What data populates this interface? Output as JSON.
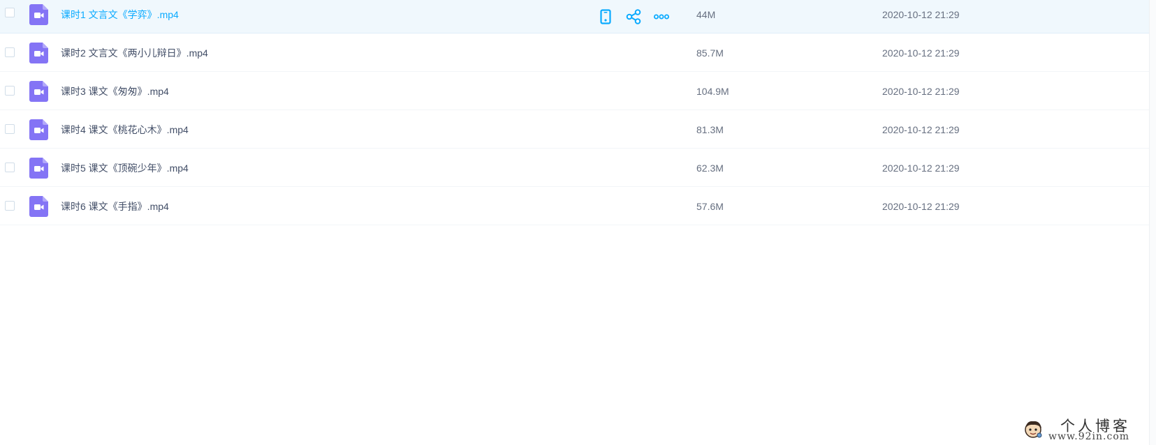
{
  "colors": {
    "accent": "#09aaff",
    "video_icon": "#8474f5",
    "row_highlight": "#f0f8fd",
    "text": "#424e67",
    "meta_text": "#666f80"
  },
  "files": [
    {
      "name": "课时1 文言文《学弈》.mp4",
      "size": "44M",
      "mtime": "2020-10-12 21:29",
      "icon": "video-file-icon"
    },
    {
      "name": "课时2 文言文《两小儿辩日》.mp4",
      "size": "85.7M",
      "mtime": "2020-10-12 21:29",
      "icon": "video-file-icon"
    },
    {
      "name": "课时3 课文《匆匆》.mp4",
      "size": "104.9M",
      "mtime": "2020-10-12 21:29",
      "icon": "video-file-icon"
    },
    {
      "name": "课时4 课文《桃花心木》.mp4",
      "size": "81.3M",
      "mtime": "2020-10-12 21:29",
      "icon": "video-file-icon"
    },
    {
      "name": "课时5 课文《顶碗少年》.mp4",
      "size": "62.3M",
      "mtime": "2020-10-12 21:29",
      "icon": "video-file-icon"
    },
    {
      "name": "课时6 课文《手指》.mp4",
      "size": "57.6M",
      "mtime": "2020-10-12 21:29",
      "icon": "video-file-icon"
    }
  ],
  "row_actions": [
    {
      "icon": "mobile-phone-icon"
    },
    {
      "icon": "share-icon"
    },
    {
      "icon": "more-dots-icon"
    }
  ],
  "watermark": {
    "title": "个人博客",
    "url": "www.92in.com"
  }
}
